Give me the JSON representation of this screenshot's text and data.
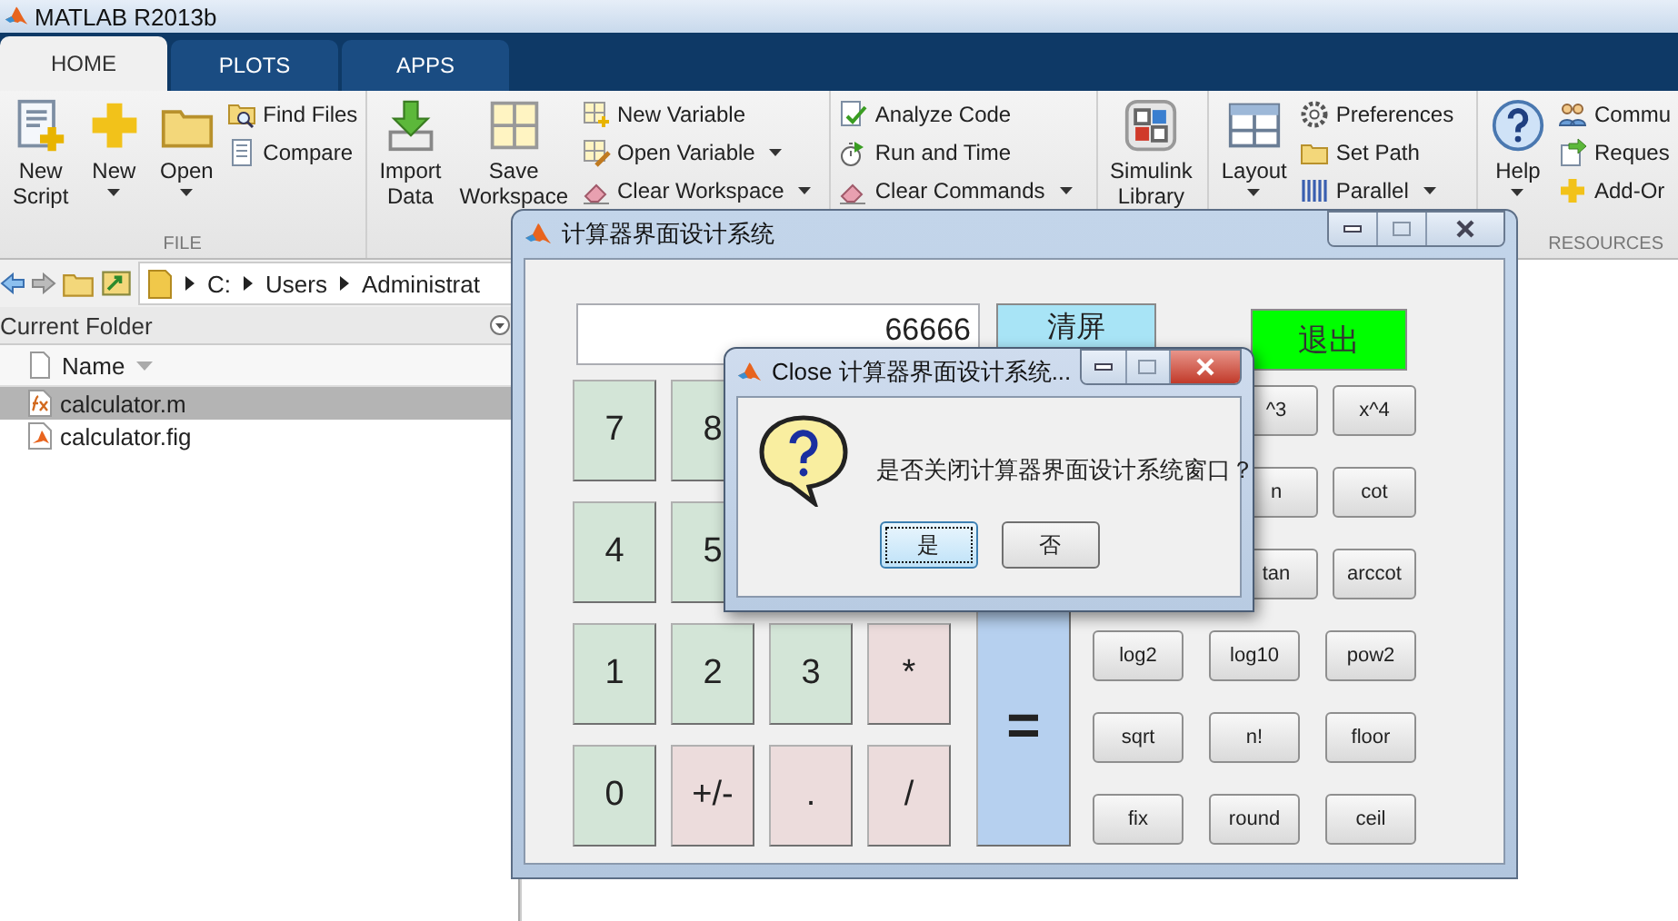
{
  "window": {
    "title": "MATLAB R2013b"
  },
  "tabs": [
    {
      "label": "HOME",
      "selected": true
    },
    {
      "label": "PLOTS",
      "selected": false
    },
    {
      "label": "APPS",
      "selected": false
    }
  ],
  "ribbon": {
    "sections": [
      {
        "label": "FILE",
        "items": [
          {
            "kind": "large",
            "label": "New Script",
            "dropdown": false
          },
          {
            "kind": "large",
            "label": "New",
            "dropdown": true
          },
          {
            "kind": "large",
            "label": "Open",
            "dropdown": true
          },
          {
            "kind": "stack",
            "items": [
              {
                "label": "Find Files",
                "dropdown": false
              },
              {
                "label": "Compare",
                "dropdown": false
              }
            ]
          }
        ]
      },
      {
        "items": [
          {
            "kind": "large",
            "label": "Import Data",
            "dropdown": false
          },
          {
            "kind": "large",
            "label": "Save Workspace",
            "dropdown": false
          },
          {
            "kind": "stack",
            "items": [
              {
                "label": "New Variable",
                "dropdown": false
              },
              {
                "label": "Open Variable",
                "dropdown": true
              },
              {
                "label": "Clear Workspace",
                "dropdown": true
              }
            ]
          }
        ]
      },
      {
        "items": [
          {
            "kind": "stack",
            "items": [
              {
                "label": "Analyze Code",
                "dropdown": false
              },
              {
                "label": "Run and Time",
                "dropdown": false
              },
              {
                "label": "Clear Commands",
                "dropdown": true
              }
            ]
          }
        ]
      },
      {
        "items": [
          {
            "kind": "large",
            "label": "Simulink Library",
            "dropdown": false
          }
        ]
      },
      {
        "items": [
          {
            "kind": "large",
            "label": "Layout",
            "dropdown": true
          },
          {
            "kind": "stack",
            "items": [
              {
                "label": "Preferences",
                "dropdown": false
              },
              {
                "label": "Set Path",
                "dropdown": false
              },
              {
                "label": "Parallel",
                "dropdown": true
              }
            ]
          }
        ]
      },
      {
        "label": "RESOURCES",
        "items": [
          {
            "kind": "large",
            "label": "Help",
            "dropdown": true
          },
          {
            "kind": "stack",
            "items": [
              {
                "label": "Commu",
                "dropdown": false
              },
              {
                "label": "Reques",
                "dropdown": false
              },
              {
                "label": "Add-Or",
                "dropdown": false
              }
            ]
          }
        ]
      }
    ]
  },
  "address_bar": {
    "segments": [
      "C:",
      "Users",
      "Administrat"
    ]
  },
  "current_folder": {
    "title": "Current Folder",
    "column": "Name",
    "files": [
      {
        "name": "calculator.m",
        "kind": "script",
        "selected": true
      },
      {
        "name": "calculator.fig",
        "kind": "figure",
        "selected": false
      }
    ]
  },
  "calculator": {
    "title": "计算器界面设计系统",
    "display": "66666",
    "top_buttons": [
      {
        "label": "清屏",
        "kind": "clear"
      },
      {
        "label": "退出",
        "kind": "exit"
      }
    ],
    "keypad": [
      [
        {
          "label": "7",
          "kind": "digit"
        },
        {
          "label": "8",
          "kind": "digit"
        }
      ],
      [
        {
          "label": "4",
          "kind": "digit"
        },
        {
          "label": "5",
          "kind": "digit"
        }
      ],
      [
        {
          "label": "1",
          "kind": "digit"
        },
        {
          "label": "2",
          "kind": "digit"
        },
        {
          "label": "3",
          "kind": "digit"
        },
        {
          "label": "*",
          "kind": "operator"
        }
      ],
      [
        {
          "label": "0",
          "kind": "digit"
        },
        {
          "label": "+/-",
          "kind": "operator"
        },
        {
          "label": ".",
          "kind": "operator"
        },
        {
          "label": "/",
          "kind": "operator"
        }
      ]
    ],
    "equals": "=",
    "functions": [
      [
        "^3",
        "x^4"
      ],
      [
        "n",
        "cot"
      ],
      [
        "tan",
        "arccot"
      ],
      [
        "log2",
        "log10",
        "pow2"
      ],
      [
        "sqrt",
        "n!",
        "floor"
      ],
      [
        "fix",
        "round",
        "ceil"
      ]
    ]
  },
  "dialog": {
    "title": "Close 计算器界面设计系统...",
    "message": "是否关闭计算器界面设计系统窗口？",
    "buttons": [
      {
        "label": "是",
        "focused": true
      },
      {
        "label": "否",
        "focused": false
      }
    ]
  }
}
